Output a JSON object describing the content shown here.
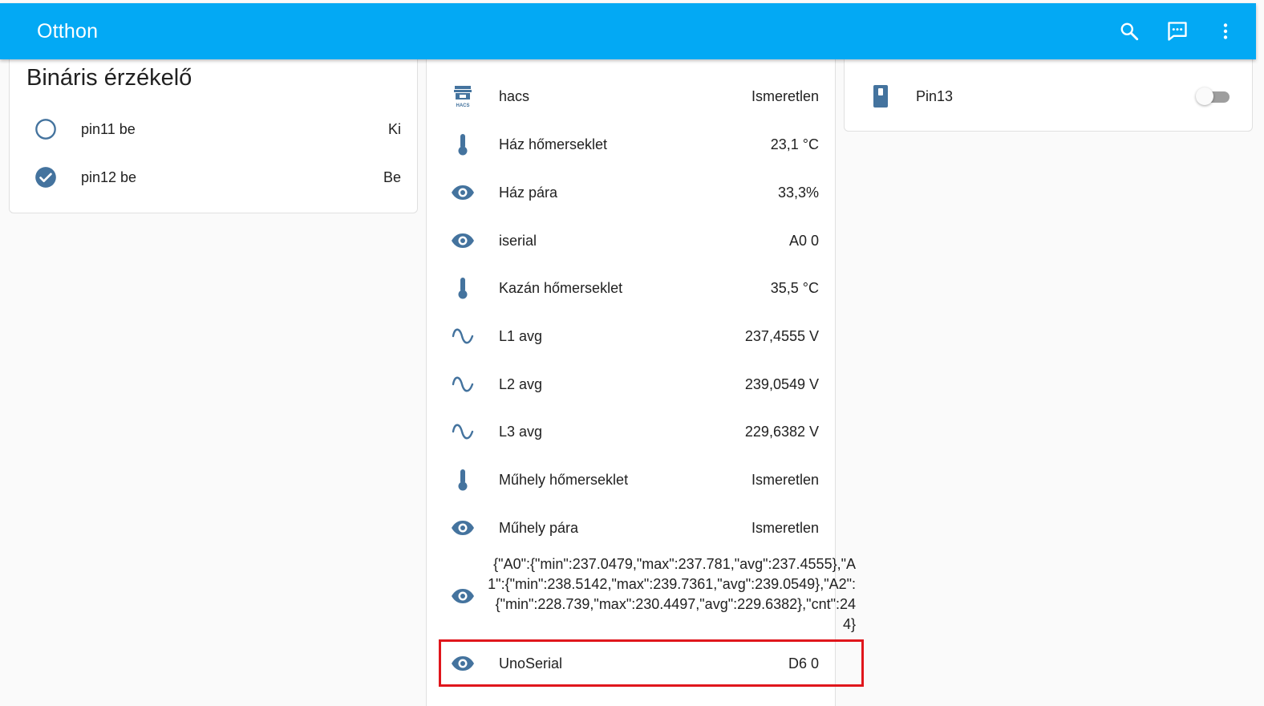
{
  "header": {
    "title": "Otthon",
    "color": "#03a9f4"
  },
  "binary_card": {
    "title": "Bináris érzékelő",
    "items": [
      {
        "name": "pin11 be",
        "state": "Ki",
        "icon": "circle-outline-icon"
      },
      {
        "name": "pin12 be",
        "state": "Be",
        "icon": "check-circle-icon"
      }
    ]
  },
  "sensor_card": {
    "items": [
      {
        "name": "hacs",
        "state": "Ismeretlen",
        "icon": "hacs-icon"
      },
      {
        "name": "Ház hőmerseklet",
        "state": "23,1 °C",
        "icon": "thermometer-icon"
      },
      {
        "name": "Ház pára",
        "state": "33,3%",
        "icon": "eye-icon"
      },
      {
        "name": "iserial",
        "state": "A0 0",
        "icon": "eye-icon"
      },
      {
        "name": "Kazán hőmerseklet",
        "state": "35,5 °C",
        "icon": "thermometer-icon"
      },
      {
        "name": "L1 avg",
        "state": "237,4555 V",
        "icon": "sine-wave-icon"
      },
      {
        "name": "L2 avg",
        "state": "239,0549 V",
        "icon": "sine-wave-icon"
      },
      {
        "name": "L3 avg",
        "state": "229,6382 V",
        "icon": "sine-wave-icon"
      },
      {
        "name": "Műhely hőmerseklet",
        "state": "Ismeretlen",
        "icon": "thermometer-icon"
      },
      {
        "name": "Műhely pára",
        "state": "Ismeretlen",
        "icon": "eye-icon"
      }
    ],
    "json_state": "{\"A0\":{\"min\":237.0479,\"max\":237.781,\"avg\":237.4555},\"A1\":{\"min\":238.5142,\"max\":239.7361,\"avg\":239.0549},\"A2\":{\"min\":228.739,\"max\":230.4497,\"avg\":229.6382},\"cnt\":244}",
    "uno": {
      "name": "UnoSerial",
      "state": "D6 0",
      "icon": "eye-icon"
    }
  },
  "switch_card": {
    "items": [
      {
        "name": "Pin13",
        "state": "off",
        "icon": "switch-icon"
      }
    ]
  },
  "colors": {
    "icon": "#44739e",
    "highlight": "#e0161c"
  }
}
